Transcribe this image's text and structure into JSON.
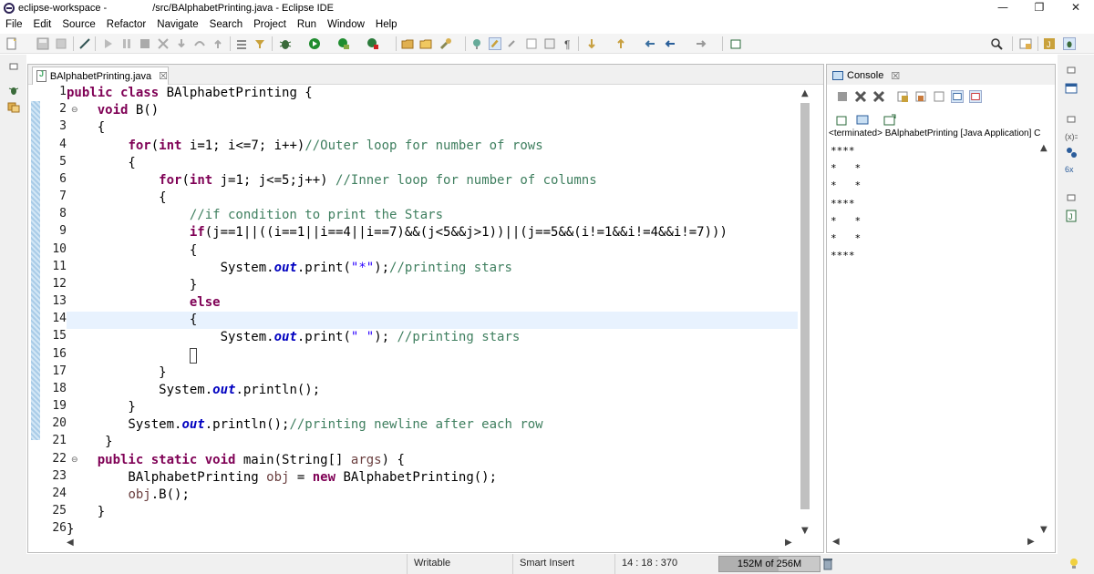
{
  "window": {
    "title_left": "eclipse-workspace -",
    "title_right": "/src/BAlphabetPrinting.java - Eclipse IDE",
    "minimize": "—",
    "maximize": "❐",
    "close": "✕"
  },
  "menu": [
    "File",
    "Edit",
    "Source",
    "Refactor",
    "Navigate",
    "Search",
    "Project",
    "Run",
    "Window",
    "Help"
  ],
  "editor": {
    "tab_label": "BAlphabetPrinting.java",
    "tab_close": "☒",
    "cursor_line": 16,
    "highlight_line": 14,
    "fold_lines": [
      2,
      22
    ],
    "lines": [
      {
        "n": "1",
        "tokens": [
          [
            "k",
            "public class "
          ],
          [
            "",
            "BAlphabetPrinting {"
          ]
        ]
      },
      {
        "n": "2",
        "tokens": [
          [
            "",
            "    "
          ],
          [
            "k",
            "void "
          ],
          [
            "",
            "B()"
          ]
        ]
      },
      {
        "n": "3",
        "tokens": [
          [
            "",
            "    {"
          ]
        ]
      },
      {
        "n": "4",
        "tokens": [
          [
            "",
            "        "
          ],
          [
            "k",
            "for"
          ],
          [
            "",
            "("
          ],
          [
            "k",
            "int "
          ],
          [
            "",
            "i=1; i<=7; i++)"
          ],
          [
            "c",
            "//Outer loop for number of rows"
          ]
        ]
      },
      {
        "n": "5",
        "tokens": [
          [
            "",
            "        {"
          ]
        ]
      },
      {
        "n": "6",
        "tokens": [
          [
            "",
            "            "
          ],
          [
            "k",
            "for"
          ],
          [
            "",
            "("
          ],
          [
            "k",
            "int "
          ],
          [
            "",
            "j=1; j<=5;j++) "
          ],
          [
            "c",
            "//Inner loop for number of columns"
          ]
        ]
      },
      {
        "n": "7",
        "tokens": [
          [
            "",
            "            {"
          ]
        ]
      },
      {
        "n": "8",
        "tokens": [
          [
            "",
            "                "
          ],
          [
            "c",
            "//if condition to print the Stars"
          ]
        ]
      },
      {
        "n": "9",
        "tokens": [
          [
            "",
            "                "
          ],
          [
            "k",
            "if"
          ],
          [
            "",
            "(j==1||((i==1||i==4||i==7)&&(j<5&&j>1))||(j==5&&(i!=1&&i!=4&&i!=7)))"
          ]
        ]
      },
      {
        "n": "10",
        "tokens": [
          [
            "",
            "                {"
          ]
        ]
      },
      {
        "n": "11",
        "tokens": [
          [
            "",
            "                    System."
          ],
          [
            "f",
            "out"
          ],
          [
            "",
            ".print("
          ],
          [
            "s",
            "\"*\""
          ],
          [
            "",
            ");"
          ],
          [
            "c",
            "//printing stars"
          ]
        ]
      },
      {
        "n": "12",
        "tokens": [
          [
            "",
            "                }"
          ]
        ]
      },
      {
        "n": "13",
        "tokens": [
          [
            "",
            "                "
          ],
          [
            "k",
            "else"
          ]
        ]
      },
      {
        "n": "14",
        "tokens": [
          [
            "",
            "                {"
          ]
        ]
      },
      {
        "n": "15",
        "tokens": [
          [
            "",
            "                    System."
          ],
          [
            "f",
            "out"
          ],
          [
            "",
            ".print("
          ],
          [
            "s",
            "\" \""
          ],
          [
            "",
            "); "
          ],
          [
            "c",
            "//printing stars"
          ]
        ]
      },
      {
        "n": "16",
        "tokens": [
          [
            "",
            "                "
          ]
        ]
      },
      {
        "n": "17",
        "tokens": [
          [
            "",
            "            }"
          ]
        ]
      },
      {
        "n": "18",
        "tokens": [
          [
            "",
            "            System."
          ],
          [
            "f",
            "out"
          ],
          [
            "",
            ".println();"
          ]
        ]
      },
      {
        "n": "19",
        "tokens": [
          [
            "",
            "        }"
          ]
        ]
      },
      {
        "n": "20",
        "tokens": [
          [
            "",
            "        System."
          ],
          [
            "f",
            "out"
          ],
          [
            "",
            ".println();"
          ],
          [
            "c",
            "//printing newline after each row"
          ]
        ]
      },
      {
        "n": "21",
        "tokens": [
          [
            "",
            "     }"
          ]
        ]
      },
      {
        "n": "22",
        "tokens": [
          [
            "",
            "    "
          ],
          [
            "k",
            "public static void "
          ],
          [
            "",
            "main(String[] "
          ],
          [
            "c2",
            "args"
          ],
          [
            "",
            ") {"
          ]
        ]
      },
      {
        "n": "23",
        "tokens": [
          [
            "",
            "        BAlphabetPrinting "
          ],
          [
            "c2",
            "obj"
          ],
          [
            "",
            " = "
          ],
          [
            "k",
            "new "
          ],
          [
            "",
            "BAlphabetPrinting();"
          ]
        ]
      },
      {
        "n": "24",
        "tokens": [
          [
            "",
            "        "
          ],
          [
            "c2",
            "obj"
          ],
          [
            "",
            ".B();"
          ]
        ]
      },
      {
        "n": "25",
        "tokens": [
          [
            "",
            "    }"
          ]
        ]
      },
      {
        "n": "26",
        "tokens": [
          [
            "",
            "}"
          ]
        ]
      }
    ]
  },
  "console": {
    "tab_label": "Console",
    "tab_close": "☒",
    "status": "<terminated> BAlphabetPrinting [Java Application] C",
    "output": "****\n*   *\n*   *\n****\n*   *\n*   *\n****"
  },
  "status": {
    "writable": "Writable",
    "insert_mode": "Smart Insert",
    "position": "14 : 18 : 370",
    "heap": "152M of 256M",
    "heap_used_fraction": 0.59
  },
  "colors": {
    "keyword": "#7f0055",
    "comment": "#3f7f5f",
    "field": "#0000c0",
    "string": "#2a00ff",
    "current_line": "#e8f2fe"
  }
}
